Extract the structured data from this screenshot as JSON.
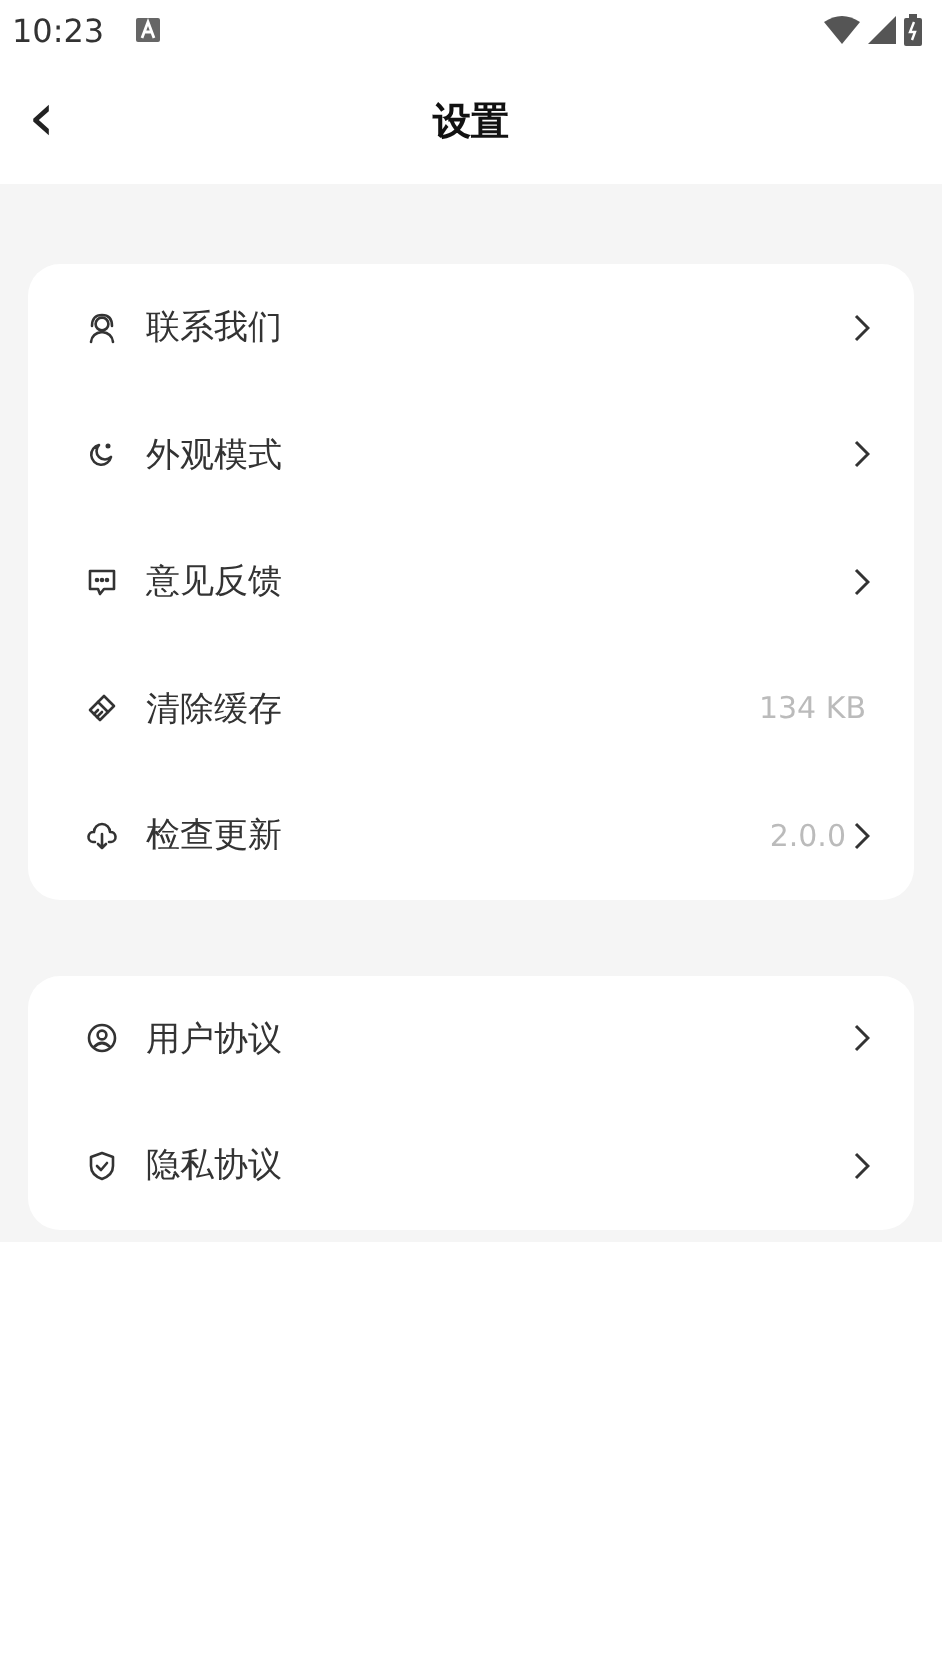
{
  "status_bar": {
    "time": "10:23"
  },
  "header": {
    "back": "‹",
    "title": "设置"
  },
  "groups": [
    {
      "items": [
        {
          "kind": "support",
          "label": "联系我们",
          "chevron": true
        },
        {
          "kind": "moon",
          "label": "外观模式",
          "chevron": true
        },
        {
          "kind": "chat",
          "label": "意见反馈",
          "chevron": true
        },
        {
          "kind": "broom",
          "label": "清除缓存",
          "value": "134 KB",
          "chevron": false
        },
        {
          "kind": "cloud",
          "label": "检查更新",
          "value": "2.0.0",
          "chevron": true
        }
      ]
    },
    {
      "items": [
        {
          "kind": "user",
          "label": "用户协议",
          "chevron": true
        },
        {
          "kind": "shield",
          "label": "隐私协议",
          "chevron": true
        }
      ]
    }
  ]
}
